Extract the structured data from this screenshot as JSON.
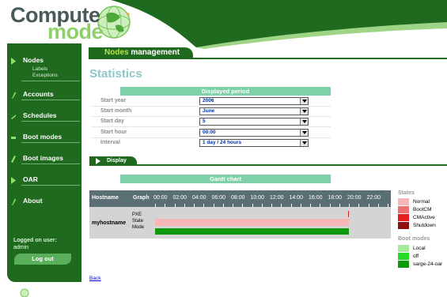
{
  "app": {
    "logo_word1": "Compute",
    "logo_word2": "mode"
  },
  "sidebar": {
    "items": [
      {
        "label": "Nodes"
      },
      {
        "label": "Accounts"
      },
      {
        "label": "Schedules"
      },
      {
        "label": "Boot modes"
      },
      {
        "label": "Boot images"
      },
      {
        "label": "OAR"
      },
      {
        "label": "About"
      }
    ],
    "sub_items": [
      {
        "label": "Labels"
      },
      {
        "label": "Exceptions"
      }
    ],
    "logged_label": "Logged on user:",
    "logged_user": "admin",
    "logout_label": "Log out"
  },
  "title": {
    "prefix": "Nodes",
    "rest": " management"
  },
  "heading": "Statistics",
  "period": {
    "header": "Displayed period",
    "fields": [
      {
        "label": "Start year",
        "value": "2006"
      },
      {
        "label": "Start month",
        "value": "June"
      },
      {
        "label": "Start day",
        "value": "5"
      },
      {
        "label": "Start hour",
        "value": "00:00"
      },
      {
        "label": "Interval",
        "value": "1 day / 24 hours"
      }
    ]
  },
  "display_button": "Display",
  "gantt": {
    "header": "Gantt chart",
    "col_hostname": "Hostname",
    "col_graph": "Graph",
    "ticks": [
      "00:00",
      "02:00",
      "04:00",
      "06:00",
      "08:00",
      "10:00",
      "12:00",
      "14:00",
      "16:00",
      "18:00",
      "20:00",
      "22:00"
    ],
    "host": "myhostname",
    "row_labels": [
      "PXE",
      "State",
      "Mode"
    ],
    "rows": {
      "pxe": [
        {
          "start_hour": 19.9,
          "end_hour": 20.0,
          "color": "#d62a2a"
        }
      ],
      "state": [
        {
          "start_hour": 0.0,
          "end_hour": 20.0,
          "color": "#f6b6b6"
        }
      ],
      "mode": [
        {
          "start_hour": 0.0,
          "end_hour": 20.0,
          "color": "#0e990e"
        }
      ]
    }
  },
  "legend": {
    "states_title": "States",
    "states": [
      {
        "label": "Normal",
        "color": "#f6b6b6"
      },
      {
        "label": "BootCM",
        "color": "#ee6f6f"
      },
      {
        "label": "CMActive",
        "color": "#e81e1e"
      },
      {
        "label": "Shutdown",
        "color": "#8c1010"
      }
    ],
    "boot_title": "Boot modes",
    "boot": [
      {
        "label": "Local",
        "color": "#a8e89a"
      },
      {
        "label": "off",
        "color": "#22dd22"
      },
      {
        "label": "sarge-24-oar",
        "color": "#0e990e"
      }
    ]
  },
  "back_link": "Back"
}
